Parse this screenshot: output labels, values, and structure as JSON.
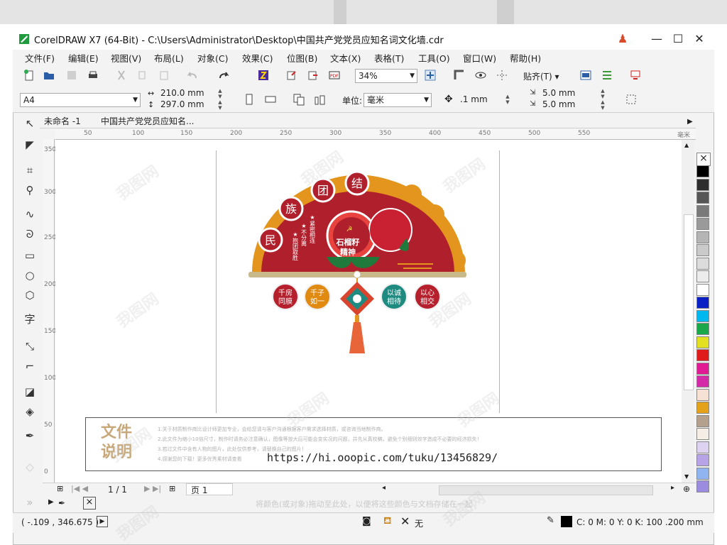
{
  "window": {
    "title": "CorelDRAW X7 (64-Bit) - C:\\Users\\Administrator\\Desktop\\中国共产党党员应知名词文化墙.cdr",
    "minimize_glyph": "—",
    "maximize_glyph": "☐",
    "close_glyph": "✕"
  },
  "menu": [
    "文件(F)",
    "编辑(E)",
    "视图(V)",
    "布局(L)",
    "对象(C)",
    "效果(C)",
    "位图(B)",
    "文本(X)",
    "表格(T)",
    "工具(O)",
    "窗口(W)",
    "帮助(H)"
  ],
  "toolbar1": {
    "zoom": "34%",
    "snap_label": "贴齐(T)"
  },
  "toolbar2": {
    "page_size": "A4",
    "width": "210.0 mm",
    "height": "297.0 mm",
    "units_label": "单位:",
    "units_value": "毫米",
    "nudge": ".1 mm",
    "dup_x": "5.0 mm",
    "dup_y": "5.0 mm"
  },
  "doc_tabs": [
    "未命名 -1",
    "中国共产党党员应知名..."
  ],
  "hruler_ticks": [
    "50",
    "100",
    "150",
    "200",
    "250",
    "300",
    "350",
    "400",
    "450",
    "500",
    "550",
    "毫米"
  ],
  "vruler_ticks": [
    "350",
    "300",
    "250",
    "200",
    "150",
    "100",
    "50",
    "0"
  ],
  "design": {
    "arch_chars": [
      "民",
      "族",
      "团",
      "结"
    ],
    "pillar_text": [
      "★紧密相连",
      "★不分离",
      "★抱团取胜"
    ],
    "center_text": [
      "石榴籽",
      "精神"
    ],
    "circles": [
      {
        "text": [
          "千房",
          "同膜"
        ],
        "color": "#b5202c"
      },
      {
        "text": [
          "千子",
          "如一"
        ],
        "color": "#e08a12"
      },
      {
        "text": [
          "以诚",
          "相待"
        ],
        "color": "#1f8a80"
      },
      {
        "text": [
          "以心",
          "相交"
        ],
        "color": "#b5202c"
      }
    ]
  },
  "notes": {
    "title_lines": [
      "文件",
      "说明"
    ],
    "lines": [
      "1.关于材质制作商比设计师更加专业，会给您请与客户沟通根据客户需求选择材质，或咨询当地制作商。",
      "2.此文件为缩小10倍尺寸，制作时请务必注意确认，图像等放大后可能会变实况的问题，并先从真校稿，避免个别细则效字造成不必要的经济损失！",
      "3.若过文件中含有人物的图片，此处仅供参考，请替换自己的图片！",
      "4.感谢您的下载！更多优秀素材请查看"
    ],
    "url": "https://hi.ooopic.com/tuku/13456829/"
  },
  "bottom_nav": {
    "page_count": "1 / 1",
    "page_tab": "页 1"
  },
  "hint": "将颜色(或对象)拖动至此处，以便将这些颜色与文档存储在一起",
  "status": {
    "coords": "( -.109 , 346.675 )",
    "fill_none": "无",
    "outline_info": "C: 0 M: 0 Y: 0 K: 100  .200 mm"
  },
  "palette_colors": [
    "#000000",
    "#2e2e2e",
    "#565656",
    "#7a7a7a",
    "#9a9a9a",
    "#b5b5b5",
    "#cacaca",
    "#dcdcdc",
    "#ececec",
    "#ffffff",
    "#0a1fc4",
    "#00b8f0",
    "#1aa84a",
    "#e2e020",
    "#e01b1b",
    "#e01b93",
    "#d42aa8",
    "#f7e1d4",
    "#e3a21a",
    "#b59f8d",
    "#f4eee4",
    "#ddd3f0",
    "#b6a4e6",
    "#8fb4f0",
    "#9b8ce0"
  ],
  "watermark": "我图网"
}
